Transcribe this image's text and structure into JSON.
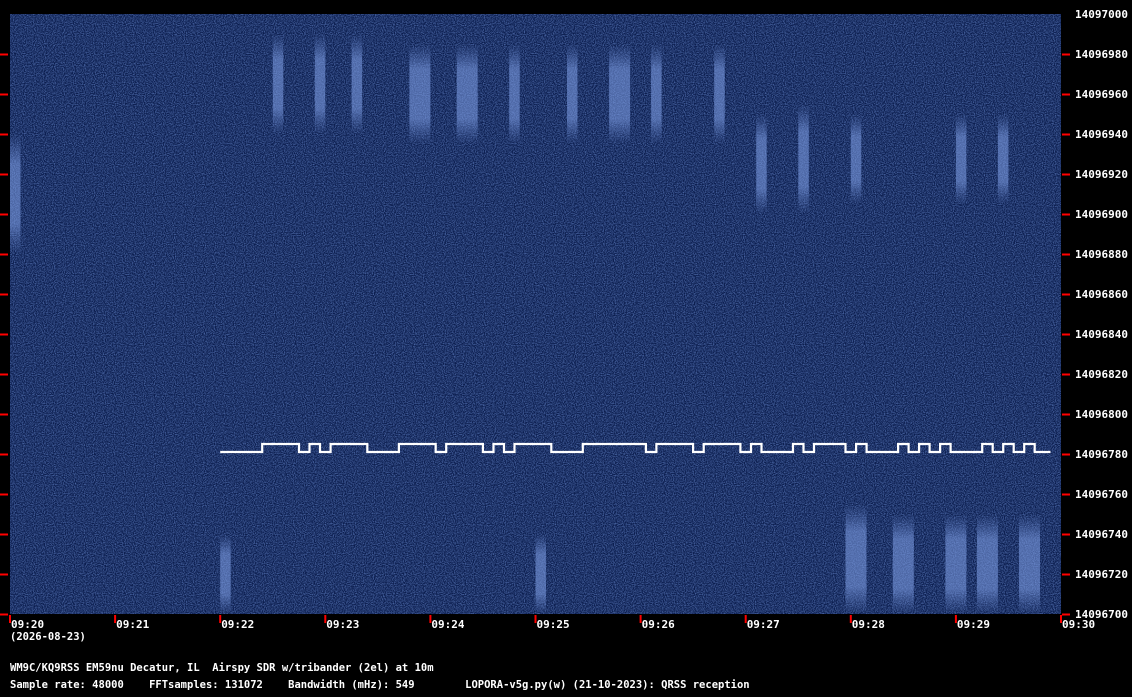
{
  "chart_data": {
    "type": "heatmap",
    "title": "",
    "xlabel": "",
    "ylabel": "",
    "x_tick_labels": [
      "09:20",
      "09:21",
      "09:22",
      "09:23",
      "09:24",
      "09:25",
      "09:26",
      "09:27",
      "09:28",
      "09:29",
      "09:30"
    ],
    "y_tick_labels": [
      "14097000",
      "14096980",
      "14096960",
      "14096940",
      "14096920",
      "14096900",
      "14096880",
      "14096860",
      "14096840",
      "14096820",
      "14096800",
      "14096780",
      "14096760",
      "14096740",
      "14096720",
      "14096700"
    ],
    "xlim": [
      "09:20",
      "09:30"
    ],
    "ylim": [
      14096700,
      14097000
    ],
    "date": "(2026-08-23)",
    "grid": false,
    "colors": {
      "background": "#0b1d4e",
      "noise_light": "#2a4fa0",
      "signal": "#ffffff",
      "tick_marks": "#ff0000"
    },
    "signal_trace": {
      "name": "",
      "low_hz": 14096781,
      "high_hz": 14096785,
      "segments": [
        [
          "09:22:00",
          "09:22:24",
          "low"
        ],
        [
          "09:22:24",
          "09:22:45",
          "high"
        ],
        [
          "09:22:45",
          "09:22:51",
          "low"
        ],
        [
          "09:22:51",
          "09:22:57",
          "high"
        ],
        [
          "09:22:57",
          "09:23:03",
          "low"
        ],
        [
          "09:23:03",
          "09:23:24",
          "high"
        ],
        [
          "09:23:24",
          "09:23:42",
          "low"
        ],
        [
          "09:23:42",
          "09:24:03",
          "high"
        ],
        [
          "09:24:03",
          "09:24:09",
          "low"
        ],
        [
          "09:24:09",
          "09:24:30",
          "high"
        ],
        [
          "09:24:30",
          "09:24:36",
          "low"
        ],
        [
          "09:24:36",
          "09:24:42",
          "high"
        ],
        [
          "09:24:42",
          "09:24:48",
          "low"
        ],
        [
          "09:24:48",
          "09:25:09",
          "high"
        ],
        [
          "09:25:09",
          "09:25:27",
          "low"
        ],
        [
          "09:25:27",
          "09:26:03",
          "high"
        ],
        [
          "09:26:03",
          "09:26:09",
          "low"
        ],
        [
          "09:26:09",
          "09:26:30",
          "high"
        ],
        [
          "09:26:30",
          "09:26:36",
          "low"
        ],
        [
          "09:26:36",
          "09:26:57",
          "high"
        ],
        [
          "09:26:57",
          "09:27:03",
          "low"
        ],
        [
          "09:27:03",
          "09:27:09",
          "high"
        ],
        [
          "09:27:09",
          "09:27:27",
          "low"
        ],
        [
          "09:27:27",
          "09:27:33",
          "high"
        ],
        [
          "09:27:33",
          "09:27:39",
          "low"
        ],
        [
          "09:27:39",
          "09:27:57",
          "high"
        ],
        [
          "09:27:57",
          "09:28:03",
          "low"
        ],
        [
          "09:28:03",
          "09:28:09",
          "high"
        ],
        [
          "09:28:09",
          "09:28:27",
          "low"
        ],
        [
          "09:28:27",
          "09:28:33",
          "high"
        ],
        [
          "09:28:33",
          "09:28:39",
          "low"
        ],
        [
          "09:28:39",
          "09:28:45",
          "high"
        ],
        [
          "09:28:45",
          "09:28:51",
          "low"
        ],
        [
          "09:28:51",
          "09:28:57",
          "high"
        ],
        [
          "09:28:57",
          "09:29:15",
          "low"
        ],
        [
          "09:29:15",
          "09:29:21",
          "high"
        ],
        [
          "09:29:21",
          "09:29:27",
          "low"
        ],
        [
          "09:29:27",
          "09:29:33",
          "high"
        ],
        [
          "09:29:33",
          "09:29:39",
          "low"
        ],
        [
          "09:29:39",
          "09:29:45",
          "high"
        ],
        [
          "09:29:45",
          "09:29:54",
          "low"
        ]
      ]
    },
    "faint_signals": [
      {
        "t_start": "09:20:00",
        "t_end": "09:20:06",
        "f_low": 14096880,
        "f_high": 14096940
      },
      {
        "t_start": "09:22:30",
        "t_end": "09:22:36",
        "f_low": 14096940,
        "f_high": 14096990
      },
      {
        "t_start": "09:22:54",
        "t_end": "09:23:00",
        "f_low": 14096940,
        "f_high": 14096990
      },
      {
        "t_start": "09:23:15",
        "t_end": "09:23:21",
        "f_low": 14096940,
        "f_high": 14096990
      },
      {
        "t_start": "09:23:48",
        "t_end": "09:24:00",
        "f_low": 14096935,
        "f_high": 14096985
      },
      {
        "t_start": "09:24:15",
        "t_end": "09:24:27",
        "f_low": 14096935,
        "f_high": 14096985
      },
      {
        "t_start": "09:24:45",
        "t_end": "09:24:51",
        "f_low": 14096935,
        "f_high": 14096985
      },
      {
        "t_start": "09:25:18",
        "t_end": "09:25:24",
        "f_low": 14096935,
        "f_high": 14096985
      },
      {
        "t_start": "09:25:42",
        "t_end": "09:25:54",
        "f_low": 14096935,
        "f_high": 14096985
      },
      {
        "t_start": "09:26:06",
        "t_end": "09:26:12",
        "f_low": 14096935,
        "f_high": 14096985
      },
      {
        "t_start": "09:26:42",
        "t_end": "09:26:48",
        "f_low": 14096935,
        "f_high": 14096985
      },
      {
        "t_start": "09:27:06",
        "t_end": "09:27:12",
        "f_low": 14096900,
        "f_high": 14096950
      },
      {
        "t_start": "09:27:30",
        "t_end": "09:27:36",
        "f_low": 14096900,
        "f_high": 14096955
      },
      {
        "t_start": "09:28:00",
        "t_end": "09:28:06",
        "f_low": 14096905,
        "f_high": 14096950
      },
      {
        "t_start": "09:29:00",
        "t_end": "09:29:06",
        "f_low": 14096905,
        "f_high": 14096950
      },
      {
        "t_start": "09:29:24",
        "t_end": "09:29:30",
        "f_low": 14096905,
        "f_high": 14096950
      },
      {
        "t_start": "09:22:00",
        "t_end": "09:22:06",
        "f_low": 14096700,
        "f_high": 14096740
      },
      {
        "t_start": "09:25:00",
        "t_end": "09:25:06",
        "f_low": 14096700,
        "f_high": 14096740
      },
      {
        "t_start": "09:27:57",
        "t_end": "09:28:09",
        "f_low": 14096700,
        "f_high": 14096755
      },
      {
        "t_start": "09:28:24",
        "t_end": "09:28:36",
        "f_low": 14096700,
        "f_high": 14096750
      },
      {
        "t_start": "09:28:54",
        "t_end": "09:29:06",
        "f_low": 14096700,
        "f_high": 14096750
      },
      {
        "t_start": "09:29:12",
        "t_end": "09:29:24",
        "f_low": 14096700,
        "f_high": 14096750
      },
      {
        "t_start": "09:29:36",
        "t_end": "09:29:48",
        "f_low": 14096700,
        "f_high": 14096750
      }
    ]
  },
  "footer": {
    "line1": "WM9C/KQ9RSS EM59nu Decatur, IL  Airspy SDR w/tribander (2el) at 10m",
    "line2": "Sample rate: 48000    FFTsamples: 131072    Bandwidth (mHz): 549        LOPORA-v5g.py(w) (21-10-2023): QRSS reception"
  }
}
